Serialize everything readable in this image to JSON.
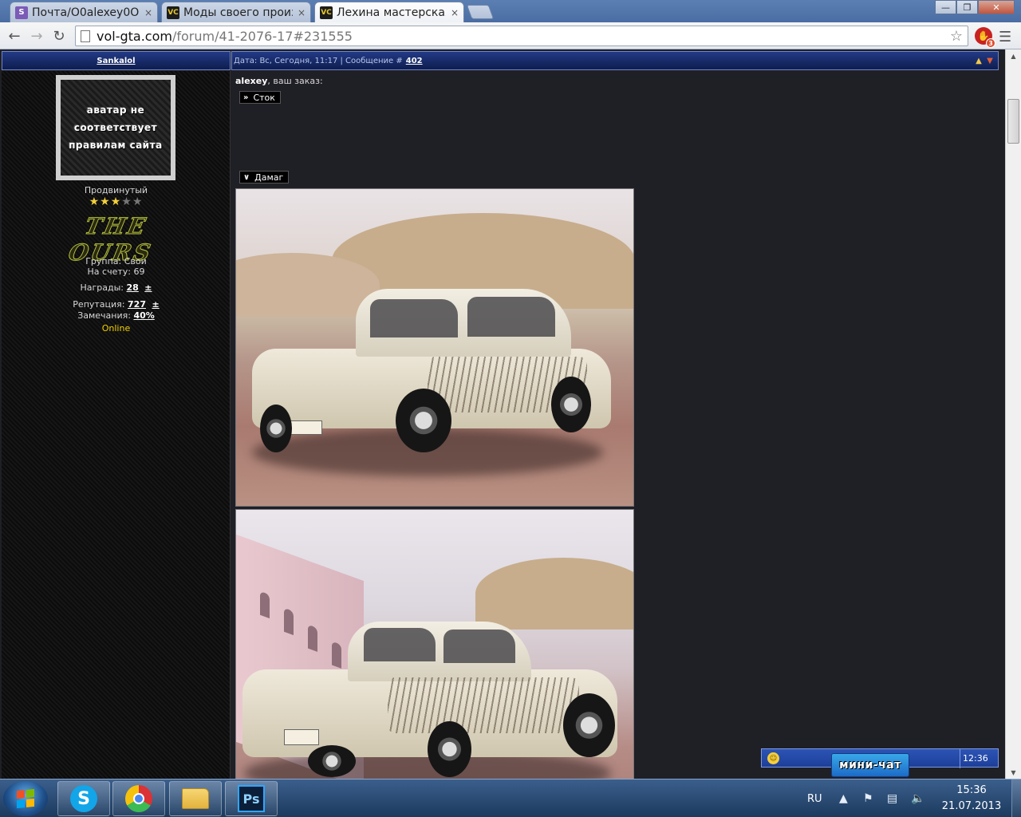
{
  "browser": {
    "tabs": [
      {
        "title": "Почта/O0alexey0O",
        "favicon": "S",
        "close": "×"
      },
      {
        "title": "Моды своего произ",
        "favicon": "VC",
        "close": "×"
      },
      {
        "title": "Лехина мастерская",
        "favicon": "VC",
        "close": "×"
      }
    ],
    "window_buttons": {
      "minimize": "—",
      "restore": "❐",
      "close": "✕"
    },
    "url_host": "vol-gta.com",
    "url_path": "/forum/41-2076-17#231555",
    "extension_badge": "3"
  },
  "post": {
    "author": "Sankalol",
    "meta": "Дата: Вс, Сегодня, 11:17 | Сообщение #",
    "number": "402",
    "greeting_name": "alexey",
    "greeting_rest": ", ваш заказ:",
    "spoiler1": "Сток",
    "spoiler2": "Дамаг"
  },
  "profile": {
    "avatar_lines": [
      "аватар не",
      "соответствует",
      "правилам сайта"
    ],
    "rank": "Продвинутый",
    "stars_on": 3,
    "stars_total": 5,
    "logo": "THE OURS",
    "group_label": "Группа:",
    "group_value": "Свои",
    "account_label": "На счету:",
    "account_value": "69",
    "awards_label": "Награды:",
    "awards_value": "28",
    "reputation_label": "Репутация:",
    "reputation_value": "727",
    "warnings_label": "Замечания:",
    "warnings_value": "40%",
    "plusminus": "±",
    "status": "Online"
  },
  "minichat": {
    "label": "мини-чат",
    "time": "12:36"
  },
  "taskbar": {
    "lang": "RU",
    "time": "15:36",
    "date": "21.07.2013"
  },
  "colors": {
    "header_blue": "#223a86",
    "online_yellow": "#f3d000",
    "page_bg": "#1f1f26"
  }
}
